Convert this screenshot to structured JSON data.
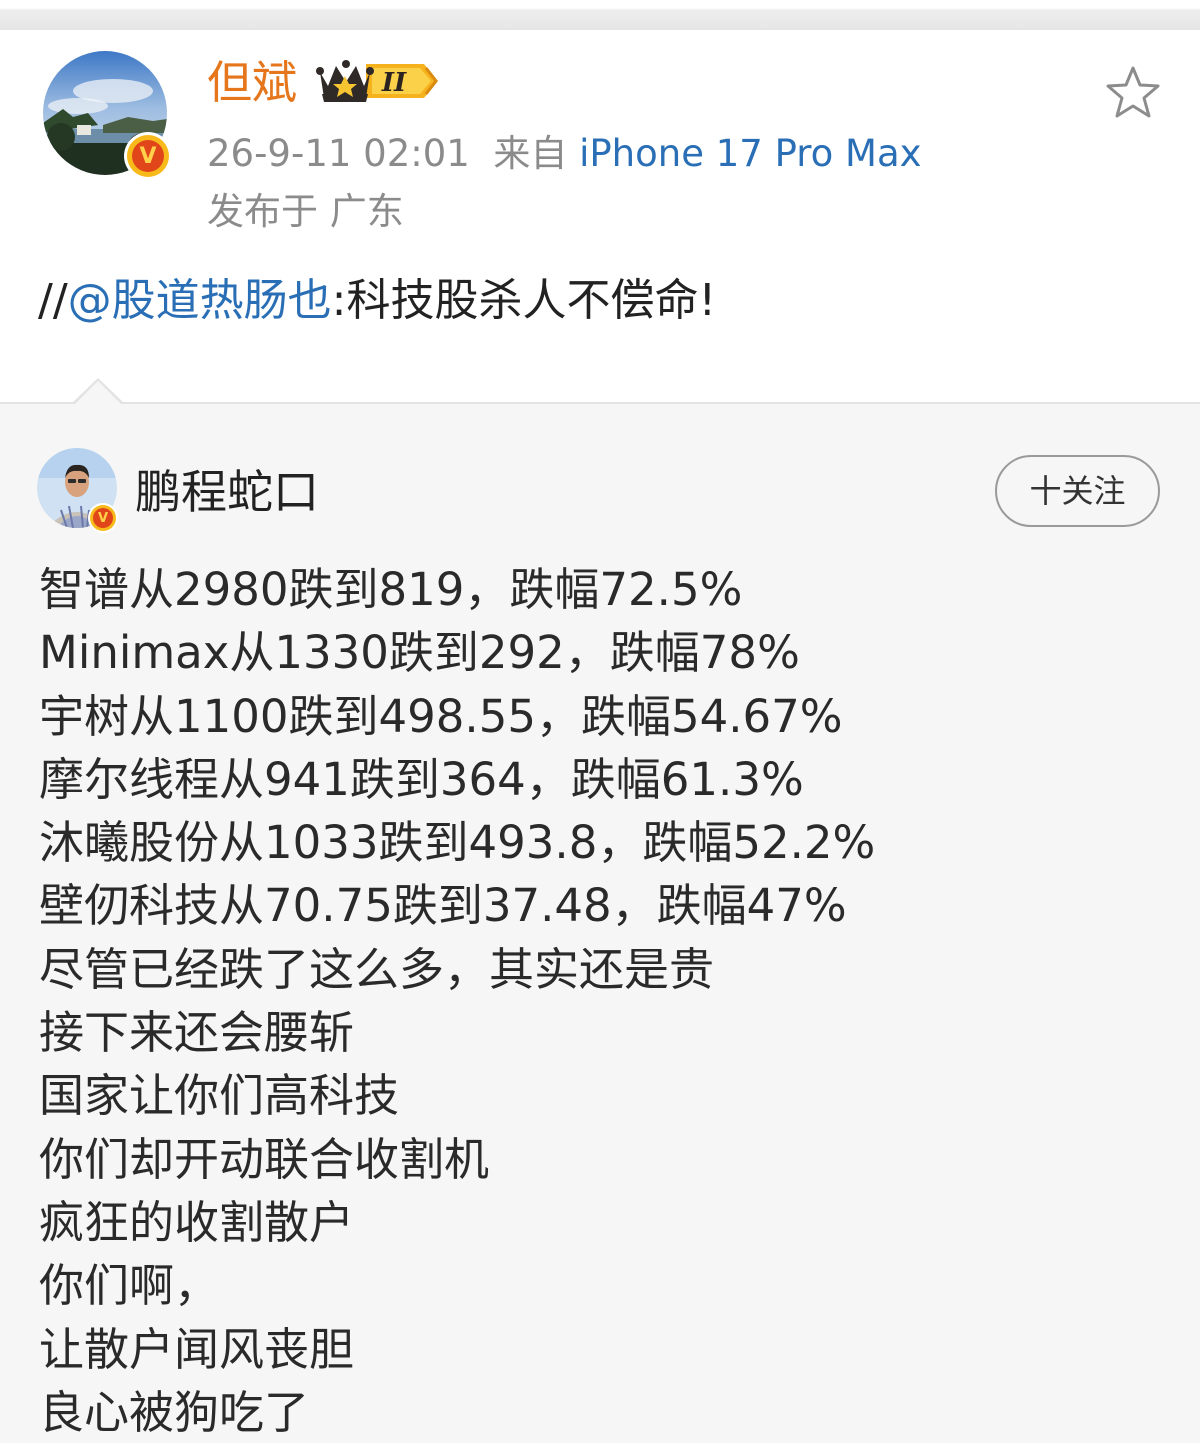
{
  "post": {
    "username": "但斌",
    "member_badge": "II",
    "timestamp": "26-9-11 02:01",
    "source_prefix": "来自",
    "source_device": "iPhone 17 Pro Max",
    "location": "发布于 广东",
    "repost": {
      "prefix": "//",
      "mention": "@股道热肠也",
      "text": ":科技股杀人不偿命!"
    }
  },
  "quoted": {
    "username": "鹏程蛇口",
    "follow_label": "十关注",
    "lines": [
      "智谱从2980跌到819，跌幅72.5%",
      "Minimax从1330跌到292，跌幅78%",
      "宇树从1100跌到498.55，跌幅54.67%",
      "摩尔线程从941跌到364，跌幅61.3%",
      "沐曦股份从1033跌到493.8，跌幅52.2%",
      "壁仞科技从70.75跌到37.48，跌幅47%",
      "尽管已经跌了这么多，其实还是贵",
      "接下来还会腰斩",
      "国家让你们高科技",
      "你们却开动联合收割机",
      "疯狂的收割散户",
      "你们啊，",
      "让散户闻风丧胆",
      "良心被狗吃了"
    ]
  },
  "icons": {
    "verified": "verified-v-icon",
    "crown": "crown-icon",
    "favorite": "star-outline-icon"
  },
  "colors": {
    "username": "#e5761c",
    "link": "#2a6fb6",
    "meta": "#8b8b8b",
    "verified_badge": "#f7ba1a",
    "quoted_background": "#f6f6f6"
  }
}
